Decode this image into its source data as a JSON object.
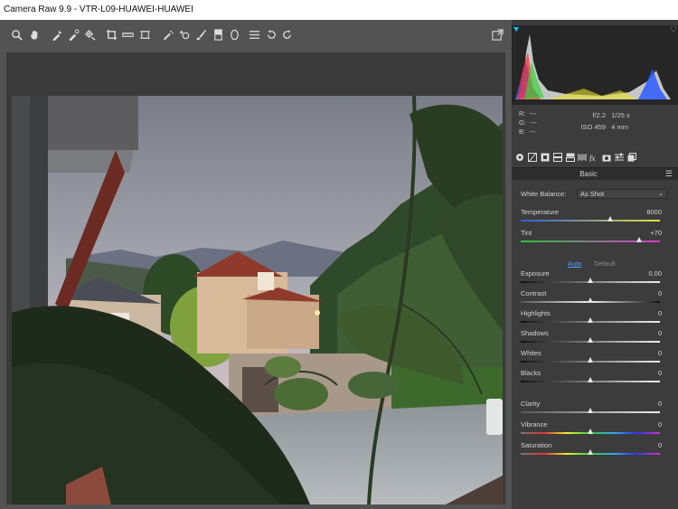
{
  "window": {
    "title": "Camera Raw 9.9  -  VTR-L09-HUAWEI-HUAWEI"
  },
  "toolbar": {
    "tools": [
      "zoom-tool-icon",
      "hand-tool-icon",
      "white-balance-icon",
      "color-sampler-icon",
      "targeted-adjustment-icon",
      "crop-icon",
      "straighten-icon",
      "transform-icon",
      "spot-removal-icon",
      "red-eye-icon",
      "adjustment-brush-icon",
      "graduated-filter-icon",
      "radial-filter-icon",
      "preferences-icon",
      "rotate-ccw-icon",
      "rotate-cw-icon"
    ],
    "fullscreen_icon": "fullscreen-icon"
  },
  "readout": {
    "r_label": "R:",
    "g_label": "G:",
    "b_label": "B:",
    "r_value": "---",
    "g_value": "---",
    "b_value": "---",
    "aperture": "f/2.2",
    "shutter": "1/25 s",
    "iso": "ISO 459",
    "focal": "4 mm"
  },
  "panel": {
    "section_title": "Basic",
    "white_balance": {
      "label": "White Balance:",
      "value": "As Shot"
    },
    "auto_label": "Auto",
    "default_label": "Default",
    "sliders": [
      {
        "id": "temperature",
        "label": "Temperature",
        "value": "8000",
        "pos": 0.64
      },
      {
        "id": "tint",
        "label": "Tint",
        "value": "+70",
        "pos": 0.85
      },
      {
        "id": "exposure",
        "label": "Exposure",
        "value": "0.00",
        "pos": 0.5
      },
      {
        "id": "contrast",
        "label": "Contrast",
        "value": "0",
        "pos": 0.5
      },
      {
        "id": "highlights",
        "label": "Highlights",
        "value": "0",
        "pos": 0.5
      },
      {
        "id": "shadows",
        "label": "Shadows",
        "value": "0",
        "pos": 0.5
      },
      {
        "id": "whites",
        "label": "Whites",
        "value": "0",
        "pos": 0.5
      },
      {
        "id": "blacks",
        "label": "Blacks",
        "value": "0",
        "pos": 0.5
      },
      {
        "id": "clarity",
        "label": "Clarity",
        "value": "0",
        "pos": 0.5
      },
      {
        "id": "vibrance",
        "label": "Vibrance",
        "value": "0",
        "pos": 0.5
      },
      {
        "id": "saturation",
        "label": "Saturation",
        "value": "0",
        "pos": 0.5
      }
    ]
  },
  "colors": {
    "panel_bg": "#3c3c3c",
    "accent_blue": "#0099ff"
  }
}
